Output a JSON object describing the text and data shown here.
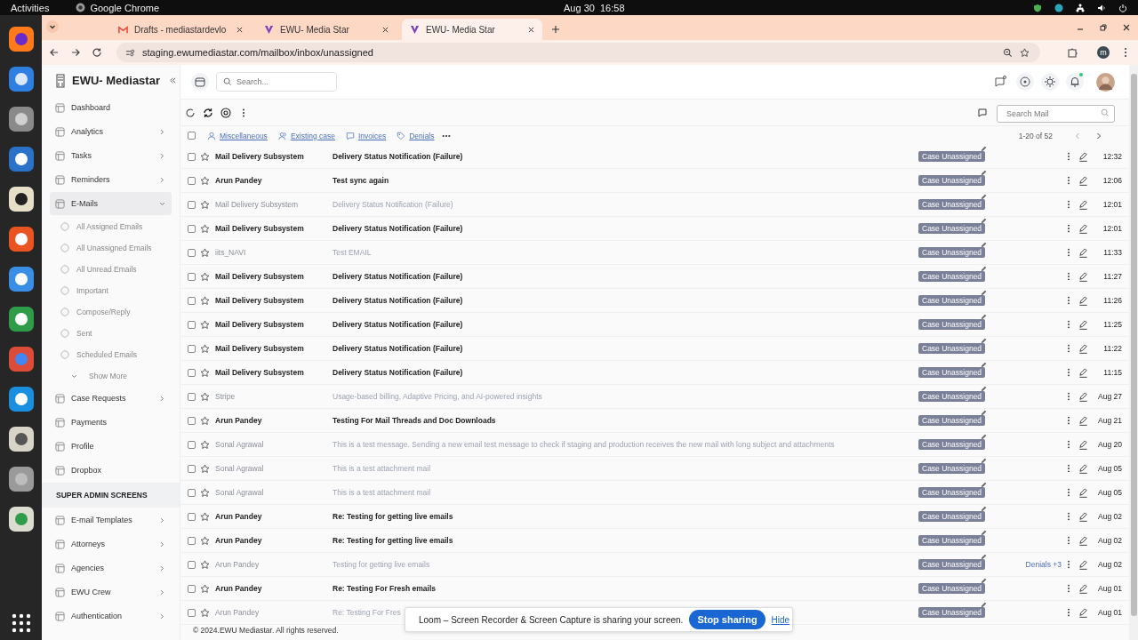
{
  "system_bar": {
    "activities": "Activities",
    "app": "Google Chrome",
    "clock": "Aug 30  16:58"
  },
  "browser": {
    "tabs": [
      {
        "title": "Drafts - mediastardevlo",
        "selected": false,
        "kind": "mail"
      },
      {
        "title": "EWU- Media Star",
        "selected": false,
        "kind": "site"
      },
      {
        "title": "EWU- Media Star",
        "selected": true,
        "kind": "site"
      }
    ],
    "url": "staging.ewumediastar.com/mailbox/inbox/unassigned",
    "profile_initial": "m"
  },
  "app": {
    "search": {
      "placeholder": "Search..."
    },
    "notifications_unread": true
  },
  "sidebar": {
    "brand": "EWU- Mediastar",
    "items": [
      {
        "label": "Dashboard",
        "kind": "link",
        "selected": false
      },
      {
        "label": "Analytics",
        "kind": "group",
        "selected": false,
        "expanded": false
      },
      {
        "label": "Tasks",
        "kind": "group",
        "selected": false,
        "expanded": false
      },
      {
        "label": "Reminders",
        "kind": "group",
        "selected": false,
        "expanded": false
      },
      {
        "label": "E-Mails",
        "kind": "group",
        "selected": true,
        "expanded": true,
        "children": [
          {
            "label": "All Assigned Emails",
            "kind": "link",
            "selected": false
          },
          {
            "label": "All Unassigned Emails",
            "kind": "link",
            "selected": false
          },
          {
            "label": "All Unread Emails",
            "kind": "link",
            "selected": false
          },
          {
            "label": "Important",
            "kind": "link",
            "selected": false
          },
          {
            "label": "Compose/Reply",
            "kind": "link",
            "selected": false
          },
          {
            "label": "Sent",
            "kind": "link",
            "selected": false
          },
          {
            "label": "Scheduled Emails",
            "kind": "link",
            "selected": false
          },
          {
            "label": "Show More",
            "kind": "more",
            "selected": false
          }
        ]
      },
      {
        "label": "Case Requests",
        "kind": "group",
        "selected": false,
        "expanded": false
      },
      {
        "label": "Payments",
        "kind": "link",
        "selected": false
      },
      {
        "label": "Profile",
        "kind": "link",
        "selected": false
      },
      {
        "label": "Dropbox",
        "kind": "link",
        "selected": false
      },
      {
        "label": "SUPER ADMIN SCREENS",
        "kind": "section"
      },
      {
        "label": "E-mail Templates",
        "kind": "group",
        "selected": false,
        "expanded": false
      },
      {
        "label": "Attorneys",
        "kind": "group",
        "selected": false,
        "expanded": false
      },
      {
        "label": "Agencies",
        "kind": "group",
        "selected": false,
        "expanded": false
      },
      {
        "label": "EWU Crew",
        "kind": "group",
        "selected": false,
        "expanded": false
      },
      {
        "label": "Authentication",
        "kind": "group",
        "selected": false,
        "expanded": false
      }
    ]
  },
  "toolbar": {
    "search_mail": {
      "placeholder": "Search Mail"
    }
  },
  "select_all": {
    "checked": false
  },
  "filters": [
    {
      "label": "Miscellaneous"
    },
    {
      "label": "Existing case"
    },
    {
      "label": "Invoices"
    },
    {
      "label": "Denials"
    }
  ],
  "pagination": "1-20 of 52",
  "emails": [
    {
      "sender": "Mail Delivery Subsystem",
      "subject": "Delivery Status Notification (Failure)",
      "unread": true,
      "tag": "Case Unassigned",
      "time": "12:32"
    },
    {
      "sender": "Arun Pandey",
      "subject": "Test sync again",
      "unread": true,
      "tag": "Case Unassigned",
      "time": "12:06"
    },
    {
      "sender": "Mail Delivery Subsystem",
      "subject": "Delivery Status Notification (Failure)",
      "unread": false,
      "tag": "Case Unassigned",
      "time": "12:01"
    },
    {
      "sender": "Mail Delivery Subsystem",
      "subject": "Delivery Status Notification (Failure)",
      "unread": true,
      "tag": "Case Unassigned",
      "time": "12:01"
    },
    {
      "sender": "iits_NAVI",
      "subject": "Test EMAIL",
      "unread": false,
      "tag": "Case Unassigned",
      "time": "11:33"
    },
    {
      "sender": "Mail Delivery Subsystem",
      "subject": "Delivery Status Notification (Failure)",
      "unread": true,
      "tag": "Case Unassigned",
      "time": "11:27"
    },
    {
      "sender": "Mail Delivery Subsystem",
      "subject": "Delivery Status Notification (Failure)",
      "unread": true,
      "tag": "Case Unassigned",
      "time": "11:26"
    },
    {
      "sender": "Mail Delivery Subsystem",
      "subject": "Delivery Status Notification (Failure)",
      "unread": true,
      "tag": "Case Unassigned",
      "time": "11:25"
    },
    {
      "sender": "Mail Delivery Subsystem",
      "subject": "Delivery Status Notification (Failure)",
      "unread": true,
      "tag": "Case Unassigned",
      "time": "11:22"
    },
    {
      "sender": "Mail Delivery Subsystem",
      "subject": "Delivery Status Notification (Failure)",
      "unread": true,
      "tag": "Case Unassigned",
      "time": "11:15"
    },
    {
      "sender": "Stripe",
      "subject": "Usage-based billing, Adaptive Pricing, and AI-powered insights",
      "unread": false,
      "tag": "Case Unassigned",
      "time": "Aug 27"
    },
    {
      "sender": "Arun Pandey",
      "subject": "Testing For Mail Threads and Doc Downloads",
      "unread": true,
      "tag": "Case Unassigned",
      "time": "Aug 21"
    },
    {
      "sender": "Sonal Agrawal",
      "subject": "This is a test message. Sending a new email test message to check if staging and production receives the new mail with long subject and attachments",
      "unread": false,
      "tag": "Case Unassigned",
      "time": "Aug 20"
    },
    {
      "sender": "Sonal Agrawal",
      "subject": "This is a test attachment mail",
      "unread": false,
      "tag": "Case Unassigned",
      "time": "Aug 05"
    },
    {
      "sender": "Sonal Agrawal",
      "subject": "This is a test attachment mail",
      "unread": false,
      "tag": "Case Unassigned",
      "time": "Aug 05"
    },
    {
      "sender": "Arun Pandey",
      "subject": "Re: Testing for getting live emails",
      "unread": true,
      "tag": "Case Unassigned",
      "time": "Aug 02"
    },
    {
      "sender": "Arun Pandey",
      "subject": "Re: Testing for getting live emails",
      "unread": true,
      "tag": "Case Unassigned",
      "time": "Aug 02"
    },
    {
      "sender": "Arun Pandey",
      "subject": "Testing for getting live emails",
      "unread": false,
      "tag": "Case Unassigned",
      "label": "Denials +3",
      "time": "Aug 02"
    },
    {
      "sender": "Arun Pandey",
      "subject": "Re: Testing For Fresh emails",
      "unread": true,
      "tag": "Case Unassigned",
      "time": "Aug 01"
    },
    {
      "sender": "Arun Pandey",
      "subject": "Re: Testing For Fres",
      "unread": false,
      "tag": "Case Unassigned",
      "time": "Aug 01"
    }
  ],
  "footer": "© 2024.EWU Mediastar. All rights reserved.",
  "screen_share": {
    "message": "Loom – Screen Recorder & Screen Capture is sharing your screen.",
    "stop": "Stop sharing",
    "hide": "Hide"
  }
}
